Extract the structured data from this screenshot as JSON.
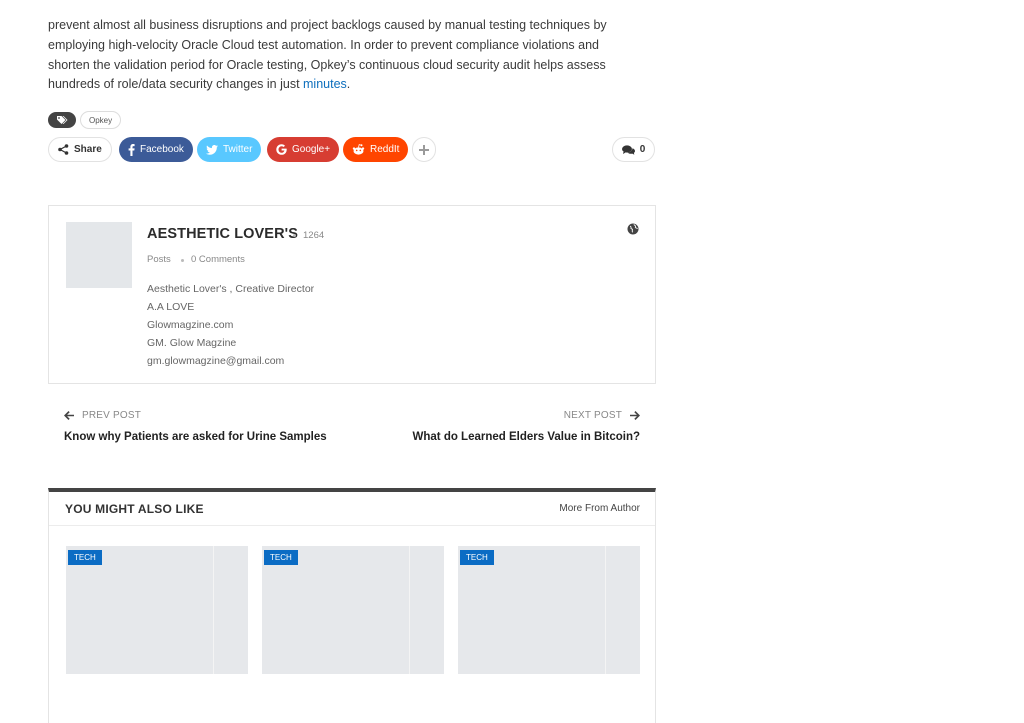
{
  "article": {
    "paragraph": "prevent almost all business disruptions and project backlogs caused by manual testing techniques by employing high-velocity Oracle Cloud test automation. In order to prevent compliance violations and shorten the validation period for Oracle testing, Opkey’s continuous cloud security audit helps assess hundreds of role/data security changes in just ",
    "link_text": "minutes",
    "trailing": "."
  },
  "tags": {
    "icon": "tag-icon",
    "items": [
      "Opkey"
    ]
  },
  "share": {
    "label": "Share",
    "facebook": "Facebook",
    "twitter": "Twitter",
    "google": "Google+",
    "reddit": "ReddIt",
    "comments_count": "0",
    "colors": {
      "facebook": "#3c5b98",
      "twitter": "#59c8ff",
      "google": "#d73d32",
      "reddit": "#ff4500"
    }
  },
  "author": {
    "name": "AESTHETIC LOVER'S",
    "posts_count": "1264",
    "posts_word": "Posts",
    "comments": "0 Comments",
    "bio": [
      "Aesthetic Lover's , Creative Director",
      "A.A LOVE",
      "Glowmagzine.com",
      "GM. Glow Magzine",
      "gm.glowmagzine@gmail.com"
    ]
  },
  "post_nav": {
    "prev_label": "PREV POST",
    "prev_title": "Know why Patients are asked for Urine Samples",
    "next_label": "NEXT POST",
    "next_title": "What do Learned Elders Value in Bitcoin?"
  },
  "related": {
    "title": "YOU MIGHT ALSO LIKE",
    "more_link": "More From Author",
    "cards": [
      {
        "badge": "TECH"
      },
      {
        "badge": "TECH"
      },
      {
        "badge": "TECH"
      }
    ],
    "accent": "#0b6cc4"
  }
}
